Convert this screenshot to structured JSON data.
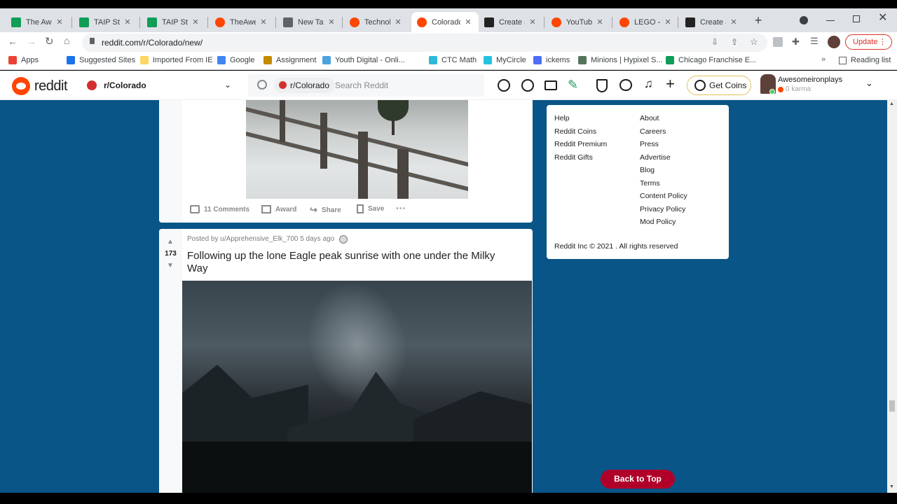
{
  "tabs": [
    {
      "title": "The Awes",
      "color": "#0f9d58",
      "glyph": "+"
    },
    {
      "title": "TAIP Stud",
      "color": "#0f9d58",
      "glyph": "+"
    },
    {
      "title": "TAIP Stud",
      "color": "#0f9d58",
      "glyph": "+"
    },
    {
      "title": "TheAwes",
      "color": "#ff4500",
      "glyph": "r"
    },
    {
      "title": "New Tab",
      "color": "#5f6368",
      "glyph": "o"
    },
    {
      "title": "Technobl",
      "color": "#ff4500",
      "glyph": "r"
    },
    {
      "title": "Colorado",
      "color": "#ff4500",
      "glyph": "r"
    },
    {
      "title": "Create a",
      "color": "#222222",
      "glyph": "▤"
    },
    {
      "title": "YouTube",
      "color": "#ff4500",
      "glyph": "r"
    },
    {
      "title": "LEGO - N",
      "color": "#ff4500",
      "glyph": "r"
    },
    {
      "title": "Create a",
      "color": "#222222",
      "glyph": "▤"
    }
  ],
  "browser": {
    "url": "reddit.com/r/Colorado/new/",
    "update_label": "Update",
    "reading_list": "Reading list"
  },
  "bookmarks": [
    {
      "label": "Apps",
      "color": "#ea4335"
    },
    {
      "label": "Suggested Sites",
      "color": "#1a73e8"
    },
    {
      "label": "Imported From IE",
      "color": "#fdd663"
    },
    {
      "label": "Google",
      "color": "#4285f4"
    },
    {
      "label": "Assignment",
      "color": "#c58b00"
    },
    {
      "label": "Youth Digital - Onli...",
      "color": "#4aa3df"
    },
    {
      "label": "CTC Math",
      "color": "#2bbbd8"
    },
    {
      "label": "MyCircle",
      "color": "#24c3e0"
    },
    {
      "label": "ickems",
      "color": "#4c6ef5"
    },
    {
      "label": "Minions | Hypixel S...",
      "color": "#55755a"
    },
    {
      "label": "Chicago Franchise E...",
      "color": "#0f9d58"
    }
  ],
  "reddit": {
    "logo": "reddit",
    "community": "r/Colorado",
    "search_chip": "r/Colorado",
    "search_placeholder": "Search Reddit",
    "get_coins": "Get Coins",
    "username": "Awesomeironplays",
    "karma": "0 karma"
  },
  "post1": {
    "comments": "11 Comments",
    "award": "Award",
    "share": "Share",
    "save": "Save"
  },
  "post2": {
    "byline": "Posted by u/Apprehensive_Elk_700 5 days ago",
    "votes": "173",
    "title": "Following up the lone Eagle peak sunrise with one under the Milky Way"
  },
  "sidebar": {
    "col1": [
      "Help",
      "Reddit Coins",
      "Reddit Premium",
      "Reddit Gifts"
    ],
    "col2": [
      "About",
      "Careers",
      "Press",
      "Advertise",
      "Blog",
      "Terms",
      "Content Policy",
      "Privacy Policy",
      "Mod Policy"
    ],
    "copyright": "Reddit Inc © 2021 . All rights reserved"
  },
  "back_to_top": "Back to Top"
}
